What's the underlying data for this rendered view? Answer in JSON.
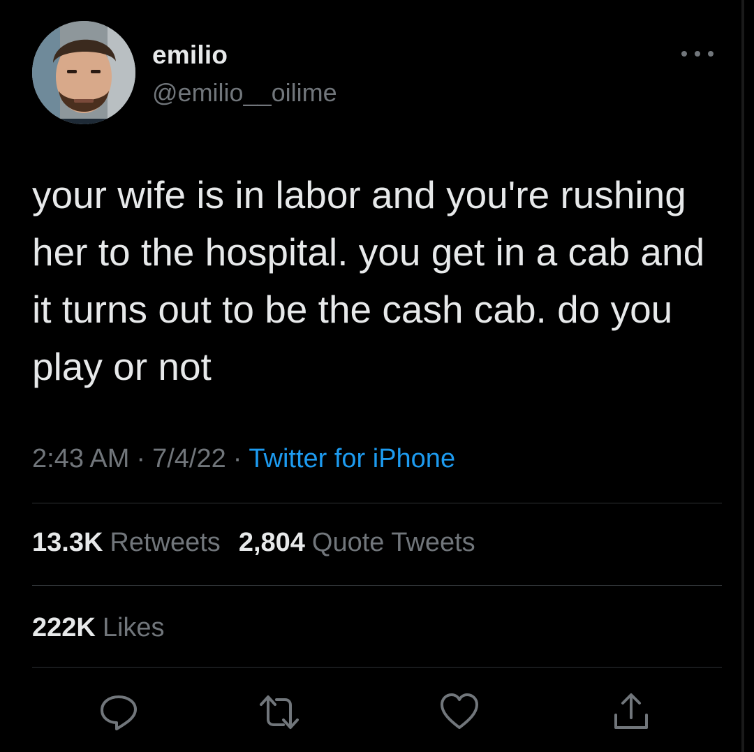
{
  "user": {
    "name": "emilio",
    "handle": "@emilio__oilime"
  },
  "tweet": {
    "text": "your wife is in labor and you're rushing her to the hospital. you get in a cab and it turns out to be the cash cab. do you play or not",
    "time": "2:43 AM",
    "date": "7/4/22",
    "separator": "·",
    "source": "Twitter for iPhone"
  },
  "stats": {
    "retweets_count": "13.3K",
    "retweets_label": "Retweets",
    "quotes_count": "2,804",
    "quotes_label": "Quote Tweets",
    "likes_count": "222K",
    "likes_label": "Likes"
  },
  "actions": [
    {
      "name": "reply",
      "icon": "reply-icon"
    },
    {
      "name": "retweet",
      "icon": "retweet-icon"
    },
    {
      "name": "like",
      "icon": "heart-icon"
    },
    {
      "name": "share",
      "icon": "share-icon"
    }
  ],
  "colors": {
    "background": "#000000",
    "primary_text": "#e7e9ea",
    "secondary_text": "#71767b",
    "link": "#1d9bf0",
    "divider": "#2f3336"
  }
}
